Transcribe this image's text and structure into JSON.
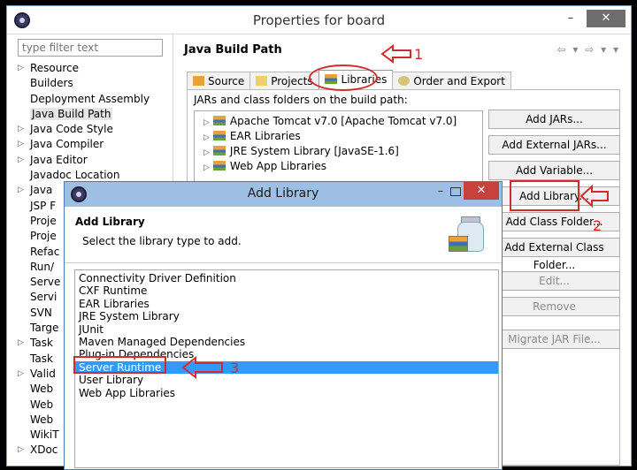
{
  "window": {
    "title": "Properties for board",
    "filter_placeholder": "type filter text",
    "minimize": "–",
    "close": "✕"
  },
  "nav_items": [
    {
      "label": "Resource",
      "arrow": true
    },
    {
      "label": "Builders",
      "arrow": false
    },
    {
      "label": "Deployment Assembly",
      "arrow": false
    },
    {
      "label": "Java Build Path",
      "arrow": false,
      "selected": true
    },
    {
      "label": "Java Code Style",
      "arrow": true
    },
    {
      "label": "Java Compiler",
      "arrow": true
    },
    {
      "label": "Java Editor",
      "arrow": true
    },
    {
      "label": "Javadoc Location",
      "arrow": false
    },
    {
      "label": "Java",
      "arrow": true
    },
    {
      "label": "JSP F",
      "arrow": false
    },
    {
      "label": "Proje",
      "arrow": false
    },
    {
      "label": "Proje",
      "arrow": false
    },
    {
      "label": "Refac",
      "arrow": false
    },
    {
      "label": "Run/",
      "arrow": false
    },
    {
      "label": "Serve",
      "arrow": false
    },
    {
      "label": "Servi",
      "arrow": false
    },
    {
      "label": "SVN",
      "arrow": false
    },
    {
      "label": "Targe",
      "arrow": false
    },
    {
      "label": "Task",
      "arrow": true
    },
    {
      "label": "Task",
      "arrow": false
    },
    {
      "label": "Valid",
      "arrow": true
    },
    {
      "label": "Web",
      "arrow": false
    },
    {
      "label": "Web",
      "arrow": false
    },
    {
      "label": "Web",
      "arrow": false
    },
    {
      "label": "WikiT",
      "arrow": false
    },
    {
      "label": "XDoc",
      "arrow": true
    }
  ],
  "main": {
    "section_title": "Java Build Path",
    "nav_arrows": "⇦ ▾ ⇨ ▾ ▾",
    "tabs": [
      {
        "label": "Source"
      },
      {
        "label": "Projects"
      },
      {
        "label": "Libraries",
        "active": true
      },
      {
        "label": "Order and Export"
      }
    ],
    "jars_label": "JARs and class folders on the build path:",
    "jar_entries": [
      "Apache Tomcat v7.0 [Apache Tomcat v7.0]",
      "EAR Libraries",
      "JRE System Library [JavaSE-1.6]",
      "Web App Libraries"
    ],
    "buttons": [
      {
        "label": "Add JARs...",
        "disabled": false
      },
      {
        "label": "Add External JARs...",
        "disabled": false
      },
      {
        "label": "Add Variable...",
        "disabled": false
      },
      {
        "label": "Add Library...",
        "disabled": false
      },
      {
        "label": "Add Class Folder...",
        "disabled": false
      },
      {
        "label": "Add External Class Folder...",
        "disabled": false
      },
      {
        "label": "Edit...",
        "disabled": true
      },
      {
        "label": "Remove",
        "disabled": true
      },
      {
        "label": "Migrate JAR File...",
        "disabled": true
      }
    ]
  },
  "dialog": {
    "title": "Add Library",
    "heading": "Add Library",
    "subheading": "Select the library type to add.",
    "minimize": "–",
    "close": "✕",
    "libraries": [
      {
        "label": "Connectivity Driver Definition"
      },
      {
        "label": "CXF Runtime"
      },
      {
        "label": "EAR Libraries"
      },
      {
        "label": "JRE System Library"
      },
      {
        "label": "JUnit"
      },
      {
        "label": "Maven Managed Dependencies"
      },
      {
        "label": "Plug-in Dependencies"
      },
      {
        "label": "Server Runtime",
        "selected": true
      },
      {
        "label": "User Library"
      },
      {
        "label": "Web App Libraries"
      }
    ]
  },
  "annotations": {
    "n1": "1",
    "n2": "2",
    "n3": "3",
    "color": "#d42a2a"
  },
  "colors": {
    "selection": "#3399ff",
    "dialog_titlebar": "#9cbfe3",
    "close_red": "#c7423a"
  }
}
